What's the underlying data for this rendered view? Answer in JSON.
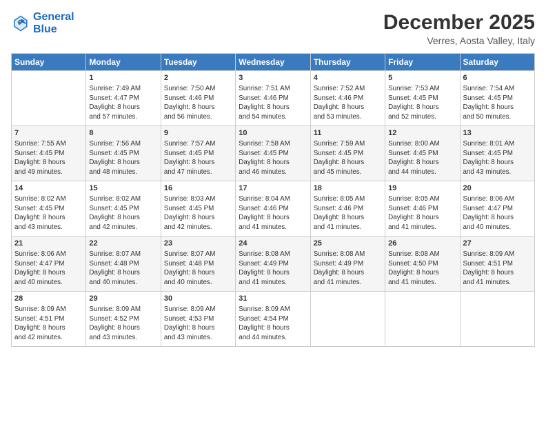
{
  "header": {
    "logo_line1": "General",
    "logo_line2": "Blue",
    "title": "December 2025",
    "subtitle": "Verres, Aosta Valley, Italy"
  },
  "days_of_week": [
    "Sunday",
    "Monday",
    "Tuesday",
    "Wednesday",
    "Thursday",
    "Friday",
    "Saturday"
  ],
  "weeks": [
    [
      {
        "day": "",
        "info": ""
      },
      {
        "day": "1",
        "info": "Sunrise: 7:49 AM\nSunset: 4:47 PM\nDaylight: 8 hours\nand 57 minutes."
      },
      {
        "day": "2",
        "info": "Sunrise: 7:50 AM\nSunset: 4:46 PM\nDaylight: 8 hours\nand 56 minutes."
      },
      {
        "day": "3",
        "info": "Sunrise: 7:51 AM\nSunset: 4:46 PM\nDaylight: 8 hours\nand 54 minutes."
      },
      {
        "day": "4",
        "info": "Sunrise: 7:52 AM\nSunset: 4:46 PM\nDaylight: 8 hours\nand 53 minutes."
      },
      {
        "day": "5",
        "info": "Sunrise: 7:53 AM\nSunset: 4:45 PM\nDaylight: 8 hours\nand 52 minutes."
      },
      {
        "day": "6",
        "info": "Sunrise: 7:54 AM\nSunset: 4:45 PM\nDaylight: 8 hours\nand 50 minutes."
      }
    ],
    [
      {
        "day": "7",
        "info": "Sunrise: 7:55 AM\nSunset: 4:45 PM\nDaylight: 8 hours\nand 49 minutes."
      },
      {
        "day": "8",
        "info": "Sunrise: 7:56 AM\nSunset: 4:45 PM\nDaylight: 8 hours\nand 48 minutes."
      },
      {
        "day": "9",
        "info": "Sunrise: 7:57 AM\nSunset: 4:45 PM\nDaylight: 8 hours\nand 47 minutes."
      },
      {
        "day": "10",
        "info": "Sunrise: 7:58 AM\nSunset: 4:45 PM\nDaylight: 8 hours\nand 46 minutes."
      },
      {
        "day": "11",
        "info": "Sunrise: 7:59 AM\nSunset: 4:45 PM\nDaylight: 8 hours\nand 45 minutes."
      },
      {
        "day": "12",
        "info": "Sunrise: 8:00 AM\nSunset: 4:45 PM\nDaylight: 8 hours\nand 44 minutes."
      },
      {
        "day": "13",
        "info": "Sunrise: 8:01 AM\nSunset: 4:45 PM\nDaylight: 8 hours\nand 43 minutes."
      }
    ],
    [
      {
        "day": "14",
        "info": "Sunrise: 8:02 AM\nSunset: 4:45 PM\nDaylight: 8 hours\nand 43 minutes."
      },
      {
        "day": "15",
        "info": "Sunrise: 8:02 AM\nSunset: 4:45 PM\nDaylight: 8 hours\nand 42 minutes."
      },
      {
        "day": "16",
        "info": "Sunrise: 8:03 AM\nSunset: 4:45 PM\nDaylight: 8 hours\nand 42 minutes."
      },
      {
        "day": "17",
        "info": "Sunrise: 8:04 AM\nSunset: 4:46 PM\nDaylight: 8 hours\nand 41 minutes."
      },
      {
        "day": "18",
        "info": "Sunrise: 8:05 AM\nSunset: 4:46 PM\nDaylight: 8 hours\nand 41 minutes."
      },
      {
        "day": "19",
        "info": "Sunrise: 8:05 AM\nSunset: 4:46 PM\nDaylight: 8 hours\nand 41 minutes."
      },
      {
        "day": "20",
        "info": "Sunrise: 8:06 AM\nSunset: 4:47 PM\nDaylight: 8 hours\nand 40 minutes."
      }
    ],
    [
      {
        "day": "21",
        "info": "Sunrise: 8:06 AM\nSunset: 4:47 PM\nDaylight: 8 hours\nand 40 minutes."
      },
      {
        "day": "22",
        "info": "Sunrise: 8:07 AM\nSunset: 4:48 PM\nDaylight: 8 hours\nand 40 minutes."
      },
      {
        "day": "23",
        "info": "Sunrise: 8:07 AM\nSunset: 4:48 PM\nDaylight: 8 hours\nand 40 minutes."
      },
      {
        "day": "24",
        "info": "Sunrise: 8:08 AM\nSunset: 4:49 PM\nDaylight: 8 hours\nand 41 minutes."
      },
      {
        "day": "25",
        "info": "Sunrise: 8:08 AM\nSunset: 4:49 PM\nDaylight: 8 hours\nand 41 minutes."
      },
      {
        "day": "26",
        "info": "Sunrise: 8:08 AM\nSunset: 4:50 PM\nDaylight: 8 hours\nand 41 minutes."
      },
      {
        "day": "27",
        "info": "Sunrise: 8:09 AM\nSunset: 4:51 PM\nDaylight: 8 hours\nand 41 minutes."
      }
    ],
    [
      {
        "day": "28",
        "info": "Sunrise: 8:09 AM\nSunset: 4:51 PM\nDaylight: 8 hours\nand 42 minutes."
      },
      {
        "day": "29",
        "info": "Sunrise: 8:09 AM\nSunset: 4:52 PM\nDaylight: 8 hours\nand 43 minutes."
      },
      {
        "day": "30",
        "info": "Sunrise: 8:09 AM\nSunset: 4:53 PM\nDaylight: 8 hours\nand 43 minutes."
      },
      {
        "day": "31",
        "info": "Sunrise: 8:09 AM\nSunset: 4:54 PM\nDaylight: 8 hours\nand 44 minutes."
      },
      {
        "day": "",
        "info": ""
      },
      {
        "day": "",
        "info": ""
      },
      {
        "day": "",
        "info": ""
      }
    ]
  ]
}
